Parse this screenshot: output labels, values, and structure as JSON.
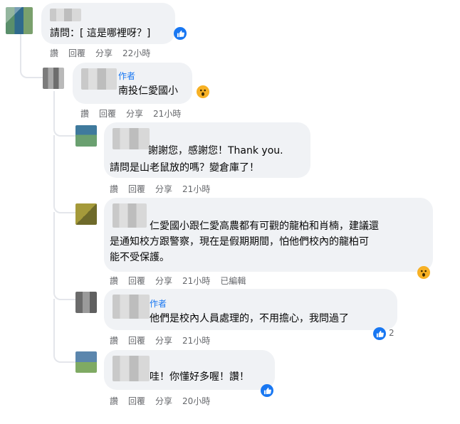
{
  "comments": [
    {
      "text": "請問：[ 這是哪裡呀？]",
      "reaction": "like-icon",
      "actions": [
        "讚",
        "回覆",
        "分享"
      ],
      "time": "22小時"
    },
    {
      "author_tag": "作者",
      "text": "南投仁愛國小",
      "reaction": "wow-icon",
      "actions": [
        "讚",
        "回覆",
        "分享"
      ],
      "time": "21小時"
    },
    {
      "text_line1": "謝謝您，感謝您！Thank you.",
      "text_line2": "請問是山老鼠放的嗎？變倉庫了！",
      "actions": [
        "讚",
        "回覆",
        "分享"
      ],
      "time": "21小時"
    },
    {
      "text_line1": "仁愛國小跟仁愛高農都有可觀的龍柏和肖楠，建議還",
      "text_line2": "是通知校方跟警察，現在是假期期間，怕他們校內的龍柏可",
      "text_line3": "能不受保護。",
      "reaction": "wow-icon",
      "actions": [
        "讚",
        "回覆",
        "分享"
      ],
      "time": "21小時",
      "edited": "已編輯"
    },
    {
      "author_tag": "作者",
      "text": "他們是校內人員處理的，不用擔心，我問過了",
      "reaction": "like-icon",
      "reaction_count": "2",
      "actions": [
        "讚",
        "回覆",
        "分享"
      ],
      "time": "21小時"
    },
    {
      "text": "哇！你懂好多喔！讚！",
      "reaction": "like-icon",
      "actions": [
        "讚",
        "回覆",
        "分享"
      ],
      "time": "20小時"
    }
  ],
  "colors": {
    "bubble": "#f0f2f5",
    "link": "#1877f2",
    "meta": "#65676b",
    "like": "#1877f2",
    "wow": "#f7b125"
  }
}
